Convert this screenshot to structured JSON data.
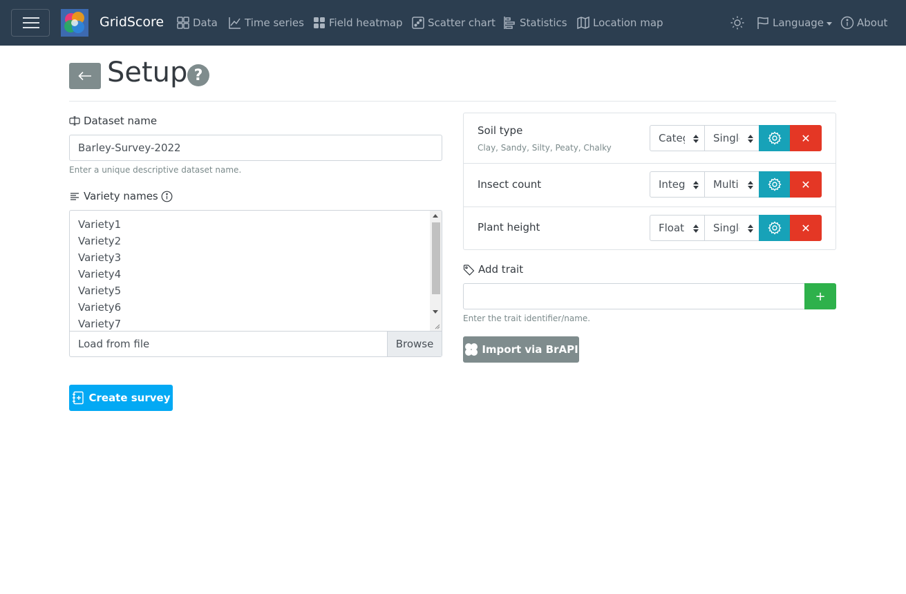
{
  "navbar": {
    "brand": "GridScore",
    "links": [
      {
        "label": "Data",
        "icon": "data-grid-icon"
      },
      {
        "label": "Time series",
        "icon": "line-chart-icon"
      },
      {
        "label": "Field heatmap",
        "icon": "heatmap-icon"
      },
      {
        "label": "Scatter chart",
        "icon": "scatter-icon"
      },
      {
        "label": "Statistics",
        "icon": "statistics-icon"
      },
      {
        "label": "Location map",
        "icon": "map-icon"
      }
    ],
    "theme_icon": "sun-icon",
    "language_label": "Language",
    "about_label": "About"
  },
  "page": {
    "title": "Setup",
    "help_glyph": "?"
  },
  "dataset": {
    "label": "Dataset name",
    "value": "Barley-Survey-2022",
    "help": "Enter a unique descriptive dataset name."
  },
  "varieties": {
    "label": "Variety names",
    "lines": [
      "Variety1",
      "Variety2",
      "Variety3",
      "Variety4",
      "Variety5",
      "Variety6",
      "Variety7"
    ],
    "file_placeholder": "Load from file",
    "browse_label": "Browse"
  },
  "create_label": "Create survey",
  "traits": [
    {
      "name": "Soil type",
      "subtitle": "Clay, Sandy, Silty, Peaty, Chalky",
      "datatype": "Categorical",
      "allow": "Single"
    },
    {
      "name": "Insect count",
      "subtitle": "",
      "datatype": "Integer",
      "allow": "Multiple"
    },
    {
      "name": "Plant height",
      "subtitle": "",
      "datatype": "Float",
      "allow": "Single"
    }
  ],
  "add_trait": {
    "label": "Add trait",
    "value": "",
    "help": "Enter the trait identifier/name.",
    "add_glyph": "+"
  },
  "brapi_label": "Import via BrAPI",
  "colors": {
    "navbar": "#2c3e50",
    "primary": "#03a9f4",
    "info": "#17a2b8",
    "danger": "#e43725",
    "success": "#2eb14b",
    "secondary": "#7f8c8d"
  }
}
